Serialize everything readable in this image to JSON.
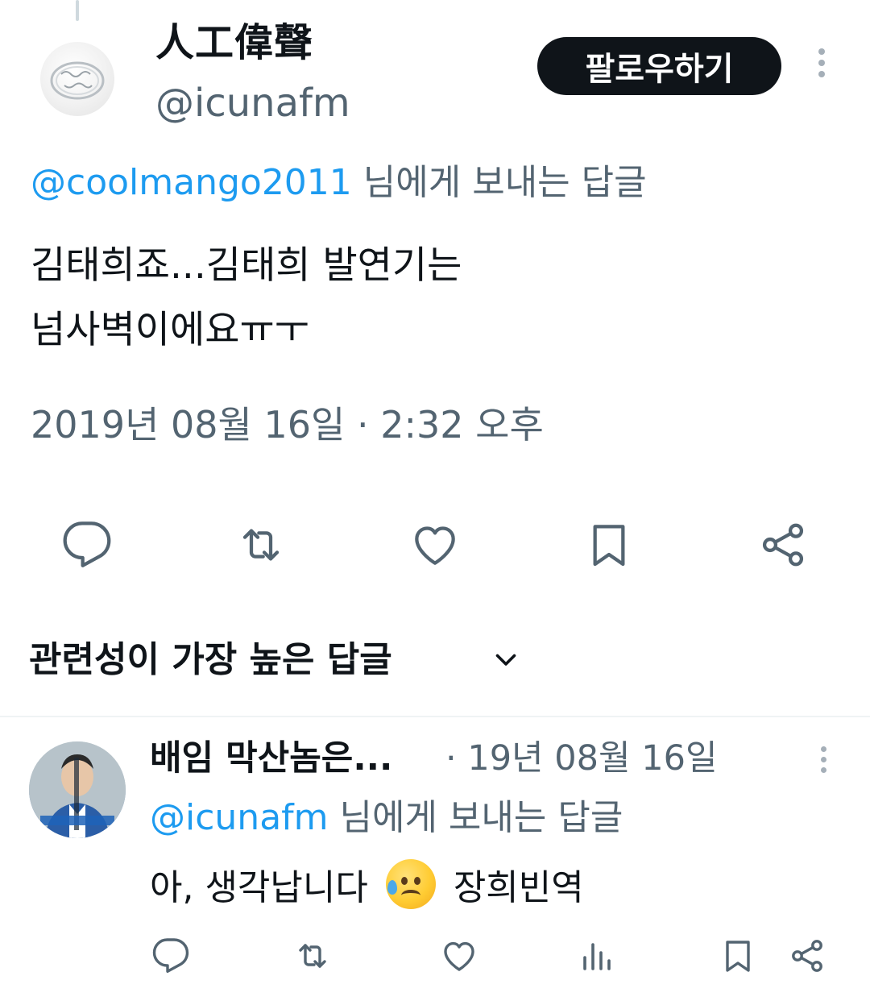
{
  "tweet": {
    "display_name": "人工偉聲",
    "handle": "@icunafm",
    "follow_label": "팔로우하기",
    "reply_to_mention": "@coolmango2011",
    "reply_to_suffix": " 님에게 보내는 답글",
    "text_line1": "김태희죠...김태희 발연기는",
    "text_line2": "넘사벽이에요ㅠㅜ",
    "timestamp": "2019년 08월 16일 · 2:32 오후",
    "avatar_icon": "ring-avatar-image",
    "actions": [
      "reply-icon",
      "retweet-icon",
      "like-icon",
      "bookmark-icon",
      "share-icon"
    ]
  },
  "sort": {
    "label": "관련성이 가장 높은 답글"
  },
  "reply": {
    "display_name": "배임 막산놈은...",
    "date": "· 19년 08월 16일",
    "reply_to_mention": "@icunafm",
    "reply_to_suffix": " 님에게 보내는 답글",
    "text_before": "아, 생각납니다 ",
    "emoji_icon": "sad-relieved-face-emoji",
    "text_after": " 장희빈역",
    "actions": [
      "reply-icon",
      "retweet-icon",
      "views-icon",
      "bookmark-icon",
      "share-icon"
    ]
  },
  "colors": {
    "text": "#0f1419",
    "secondary": "#536471",
    "link": "#1d9bf0",
    "icon": "#536471",
    "button_bg": "#0f1419"
  }
}
